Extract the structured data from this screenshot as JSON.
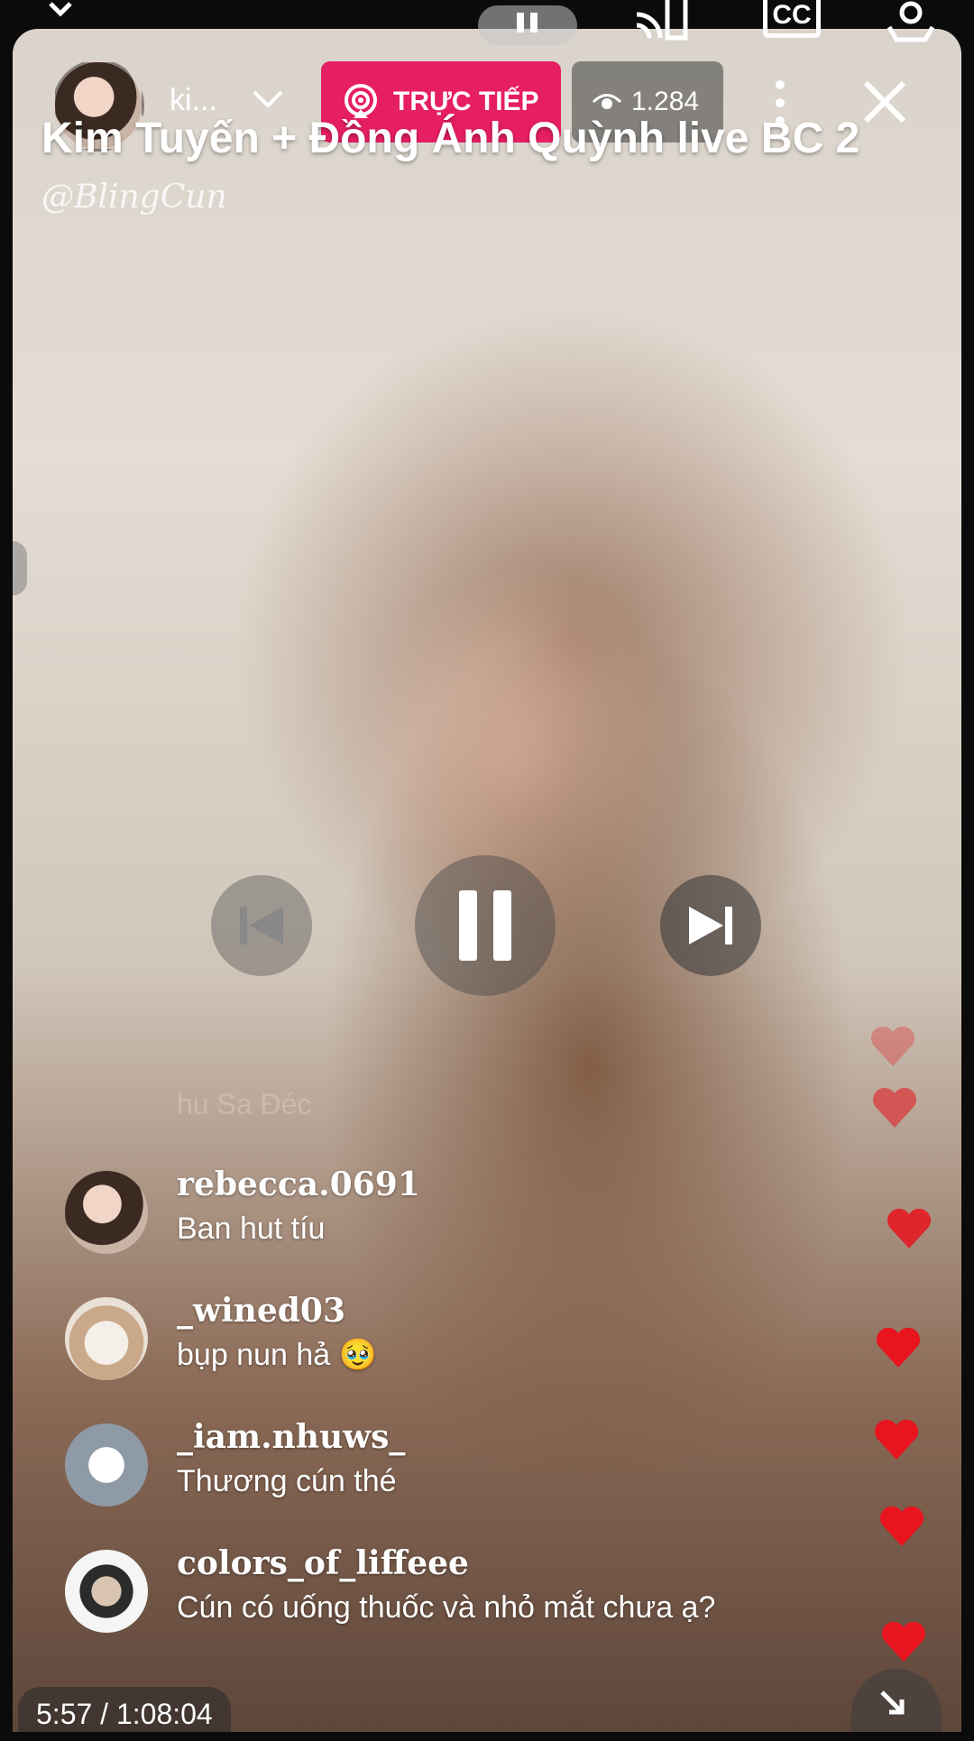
{
  "host": {
    "short_name": "ki...",
    "avatar": "host-avatar"
  },
  "live_badge": {
    "label": "TRỰC TIẾP",
    "icon": "live-broadcast-icon",
    "color": "#e61e63"
  },
  "viewers": {
    "count": "1.284",
    "icon": "eye-icon"
  },
  "stream": {
    "title": "Kim Tuyến + Đồng Ánh Quỳnh live BC 2",
    "channel": "@BlingCun"
  },
  "system_bar": {
    "icons": [
      "chevron-down-icon",
      "pause-icon",
      "cast-icon",
      "closed-captions-icon",
      "settings-icon"
    ],
    "cc_label": "CC"
  },
  "controls": {
    "previous": "skip-previous-icon",
    "pause": "pause-icon",
    "next": "skip-next-icon"
  },
  "comments": [
    {
      "user": "rebecca.0691",
      "text": "Ban hut tíu"
    },
    {
      "user": "_wined03",
      "text": "bụp nun hả 🥹"
    },
    {
      "user": "_iam.nhuws_",
      "text": "Thương cún thé"
    },
    {
      "user": "colors_of_liffeee",
      "text": "Cún có uống thuốc và nhỏ mắt chưa ạ?"
    }
  ],
  "faded_comment": "hu Sa Đéc",
  "reactions": {
    "icon": "heart-icon",
    "color": "#e8141e"
  },
  "playback": {
    "time": "5:57 / 1:08:04"
  }
}
